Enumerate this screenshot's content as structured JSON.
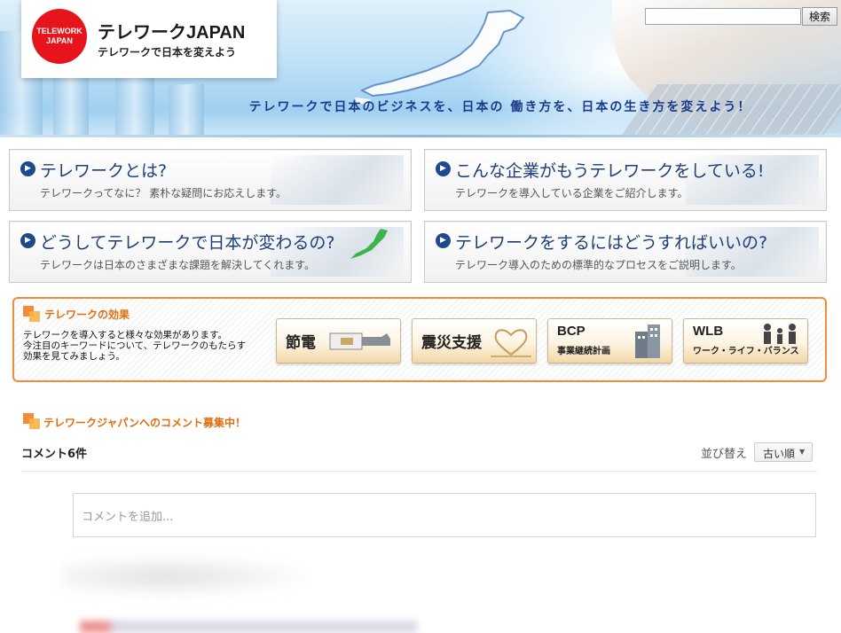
{
  "header": {
    "logo_badge_line1": "TELEWORK",
    "logo_badge_line2": "JAPAN",
    "logo_title": "テレワークJAPAN",
    "logo_subtitle": "テレワークで日本を変えよう",
    "tagline": "テレワークで日本のビジネスを、日本の 働き方を、日本の生き方を変えよう！",
    "search": {
      "placeholder": "",
      "button_label": "検索"
    }
  },
  "features": [
    {
      "title": "テレワークとは?",
      "description": "テレワークってなに？ 素朴な疑問にお応えします。"
    },
    {
      "title": "こんな企業がもうテレワークをしている!",
      "description": "テレワークを導入している企業をご紹介します。"
    },
    {
      "title": "どうしてテレワークで日本が変わるの?",
      "description": "テレワークは日本のさまざまな課題を解決してくれます。"
    },
    {
      "title": "テレワークをするにはどうすればいいの?",
      "description": "テレワーク導入のための標準的なプロセスをご説明します。"
    }
  ],
  "effects": {
    "title": "テレワークの効果",
    "description_lines": [
      "テレワークを導入すると様々な効果があります。",
      "今注目のキーワードについて、テレワークのもたらす",
      "効果を見てみましょう。"
    ],
    "buttons": [
      {
        "label": "節電"
      },
      {
        "label": "震災支援"
      },
      {
        "label": "BCP",
        "sublabel": "事業継続計画"
      },
      {
        "label": "WLB",
        "sublabel": "ワーク・ライフ・バランス"
      }
    ]
  },
  "comments": {
    "heading": "テレワークジャパンへのコメント募集中！",
    "count_label": "コメント6件",
    "sort_label": "並び替え",
    "sort_selected": "古い順",
    "input_placeholder": "コメントを追加..."
  },
  "colors": {
    "accent_orange": "#f08c3a",
    "title_blue": "#1e3f7a",
    "logo_red": "#e8141c"
  },
  "icons": [
    "arrow-circle-icon",
    "orange-squares-icon",
    "plug-icon",
    "heart-icon",
    "building-icon",
    "family-icon",
    "caret-down-icon"
  ]
}
